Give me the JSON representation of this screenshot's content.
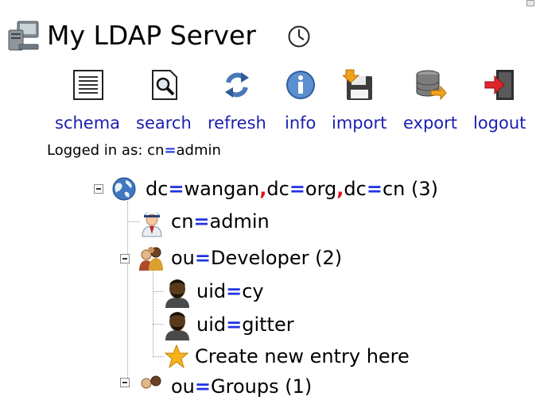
{
  "header": {
    "title": "My LDAP Server",
    "icons": {
      "server": "server-computer-icon",
      "clock": "clock-icon"
    }
  },
  "toolbar": {
    "items": [
      {
        "label": "schema",
        "icon": "schema-document-icon"
      },
      {
        "label": "search",
        "icon": "search-magnifier-icon"
      },
      {
        "label": "refresh",
        "icon": "refresh-arrows-icon"
      },
      {
        "label": "info",
        "icon": "info-icon"
      },
      {
        "label": "import",
        "icon": "import-floppy-icon"
      },
      {
        "label": "export",
        "icon": "export-database-icon"
      },
      {
        "label": "logout",
        "icon": "logout-door-icon"
      }
    ]
  },
  "session": {
    "logged_in_prefix": "Logged in as: ",
    "user_attr": "cn",
    "user_value": "admin"
  },
  "tree": {
    "root": {
      "parts": [
        [
          "dc",
          "wangan"
        ],
        [
          "dc",
          "org"
        ],
        [
          "dc",
          "cn"
        ]
      ],
      "count": "(3)",
      "icon": "globe-icon"
    },
    "children": [
      {
        "attr": "cn",
        "value": "admin",
        "icon": "admin-user-icon"
      },
      {
        "attr": "ou",
        "value": "Developer",
        "count": "(2)",
        "icon": "group-icon",
        "children": [
          {
            "attr": "uid",
            "value": "cy",
            "icon": "person-icon"
          },
          {
            "attr": "uid",
            "value": "gitter",
            "icon": "person-icon"
          }
        ],
        "create_entry": {
          "label": "Create new entry here",
          "icon": "star-icon"
        }
      }
    ],
    "partial_next": {
      "attr": "ou",
      "value": "Groups",
      "count": "(1)"
    }
  },
  "colors": {
    "link": "#1b1fae",
    "equals": "#1f33e0",
    "comma": "#e01414"
  }
}
